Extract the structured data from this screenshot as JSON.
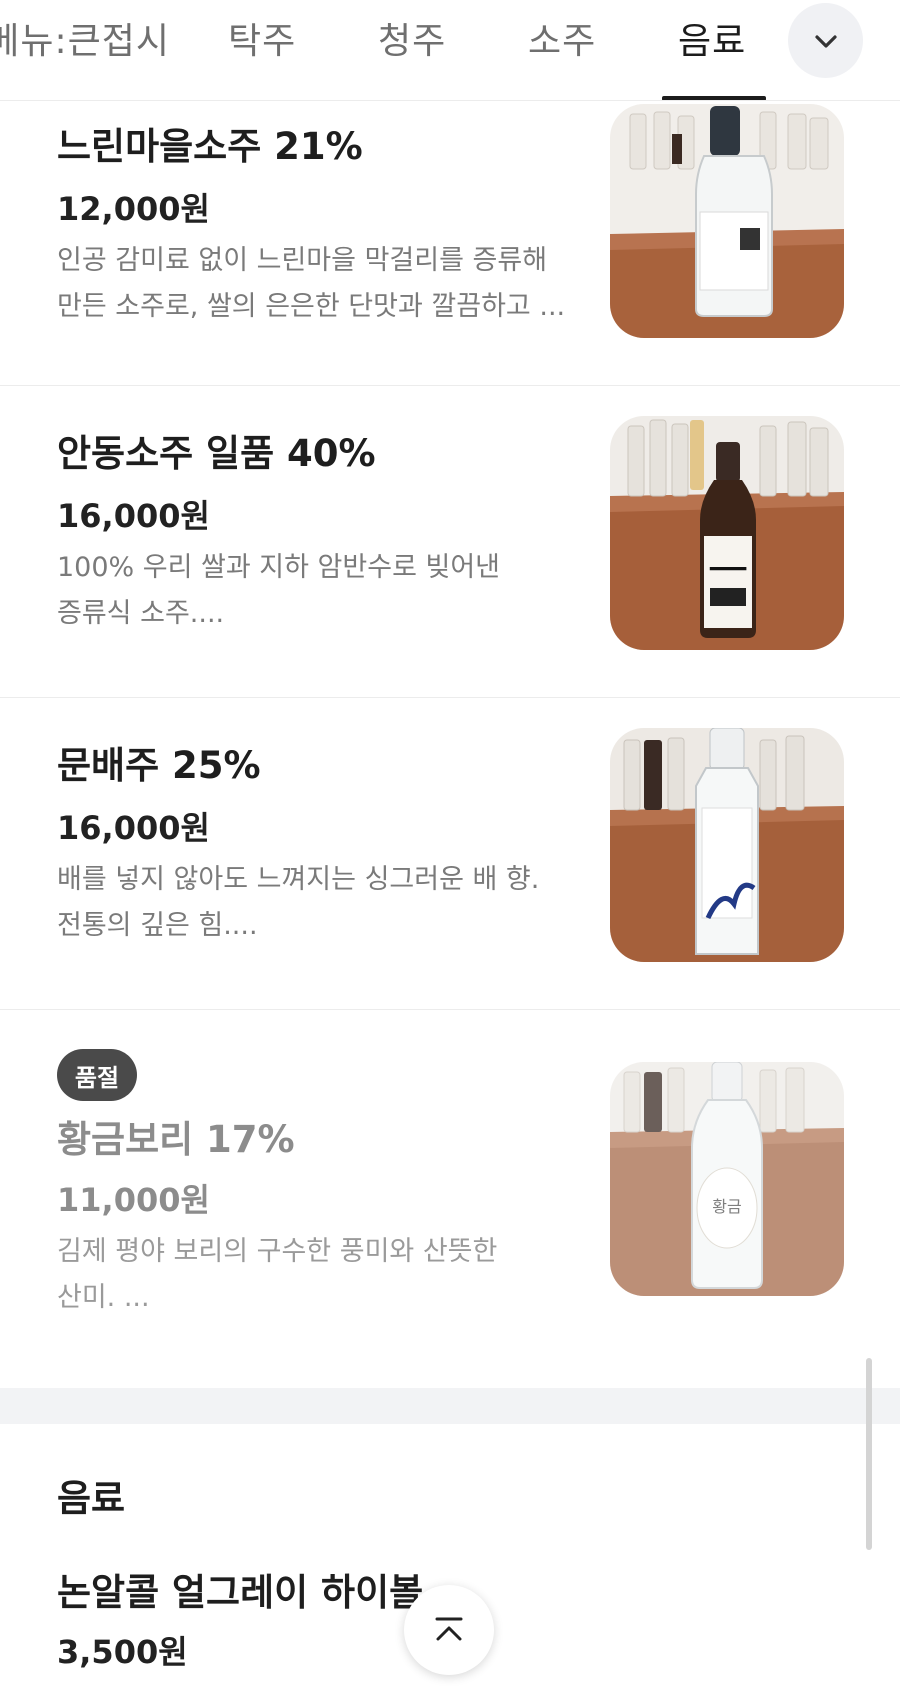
{
  "tabs": [
    {
      "label": "계절메뉴:큰접시",
      "active": false
    },
    {
      "label": "탁주",
      "active": false
    },
    {
      "label": "청주",
      "active": false
    },
    {
      "label": "소주",
      "active": false
    },
    {
      "label": "음료",
      "active": true
    }
  ],
  "tab_expand_icon": "chevron-down-icon",
  "products": [
    {
      "name": "느린마을소주 21%",
      "price": "12,000원",
      "desc_line1": "인공 감미료 없이 느린마을 막걸리를 증류해",
      "desc_line2": "만든 소주로, 쌀의 은은한 단맛과 깔끔하고 ...",
      "sold_out": false
    },
    {
      "name": "안동소주 일품 40%",
      "price": "16,000원",
      "desc_line1": "100% 우리 쌀과 지하 암반수로 빚어낸",
      "desc_line2": "증류식 소주....",
      "sold_out": false
    },
    {
      "name": "문배주 25%",
      "price": "16,000원",
      "desc_line1": "배를 넣지 않아도 느껴지는 싱그러운 배 향.",
      "desc_line2": "전통의 깊은 힘....",
      "sold_out": false
    },
    {
      "name": "황금보리 17%",
      "price": "11,000원",
      "desc_line1": "김제 평야 보리의 구수한 풍미와 산뜻한",
      "desc_line2": "산미. ...",
      "sold_out": true,
      "badge": "품절"
    }
  ],
  "section": {
    "title": "음료",
    "first_item": {
      "name": "논알콜 얼그레이 하이볼",
      "price": "3,500원"
    }
  },
  "scroll_top_icon": "arrow-up-to-top-icon",
  "colors": {
    "accent": "#1c1c1c",
    "badge": "#4a4a4a",
    "muted_text": "#7a7a7a",
    "section_gap": "#f2f3f5"
  }
}
